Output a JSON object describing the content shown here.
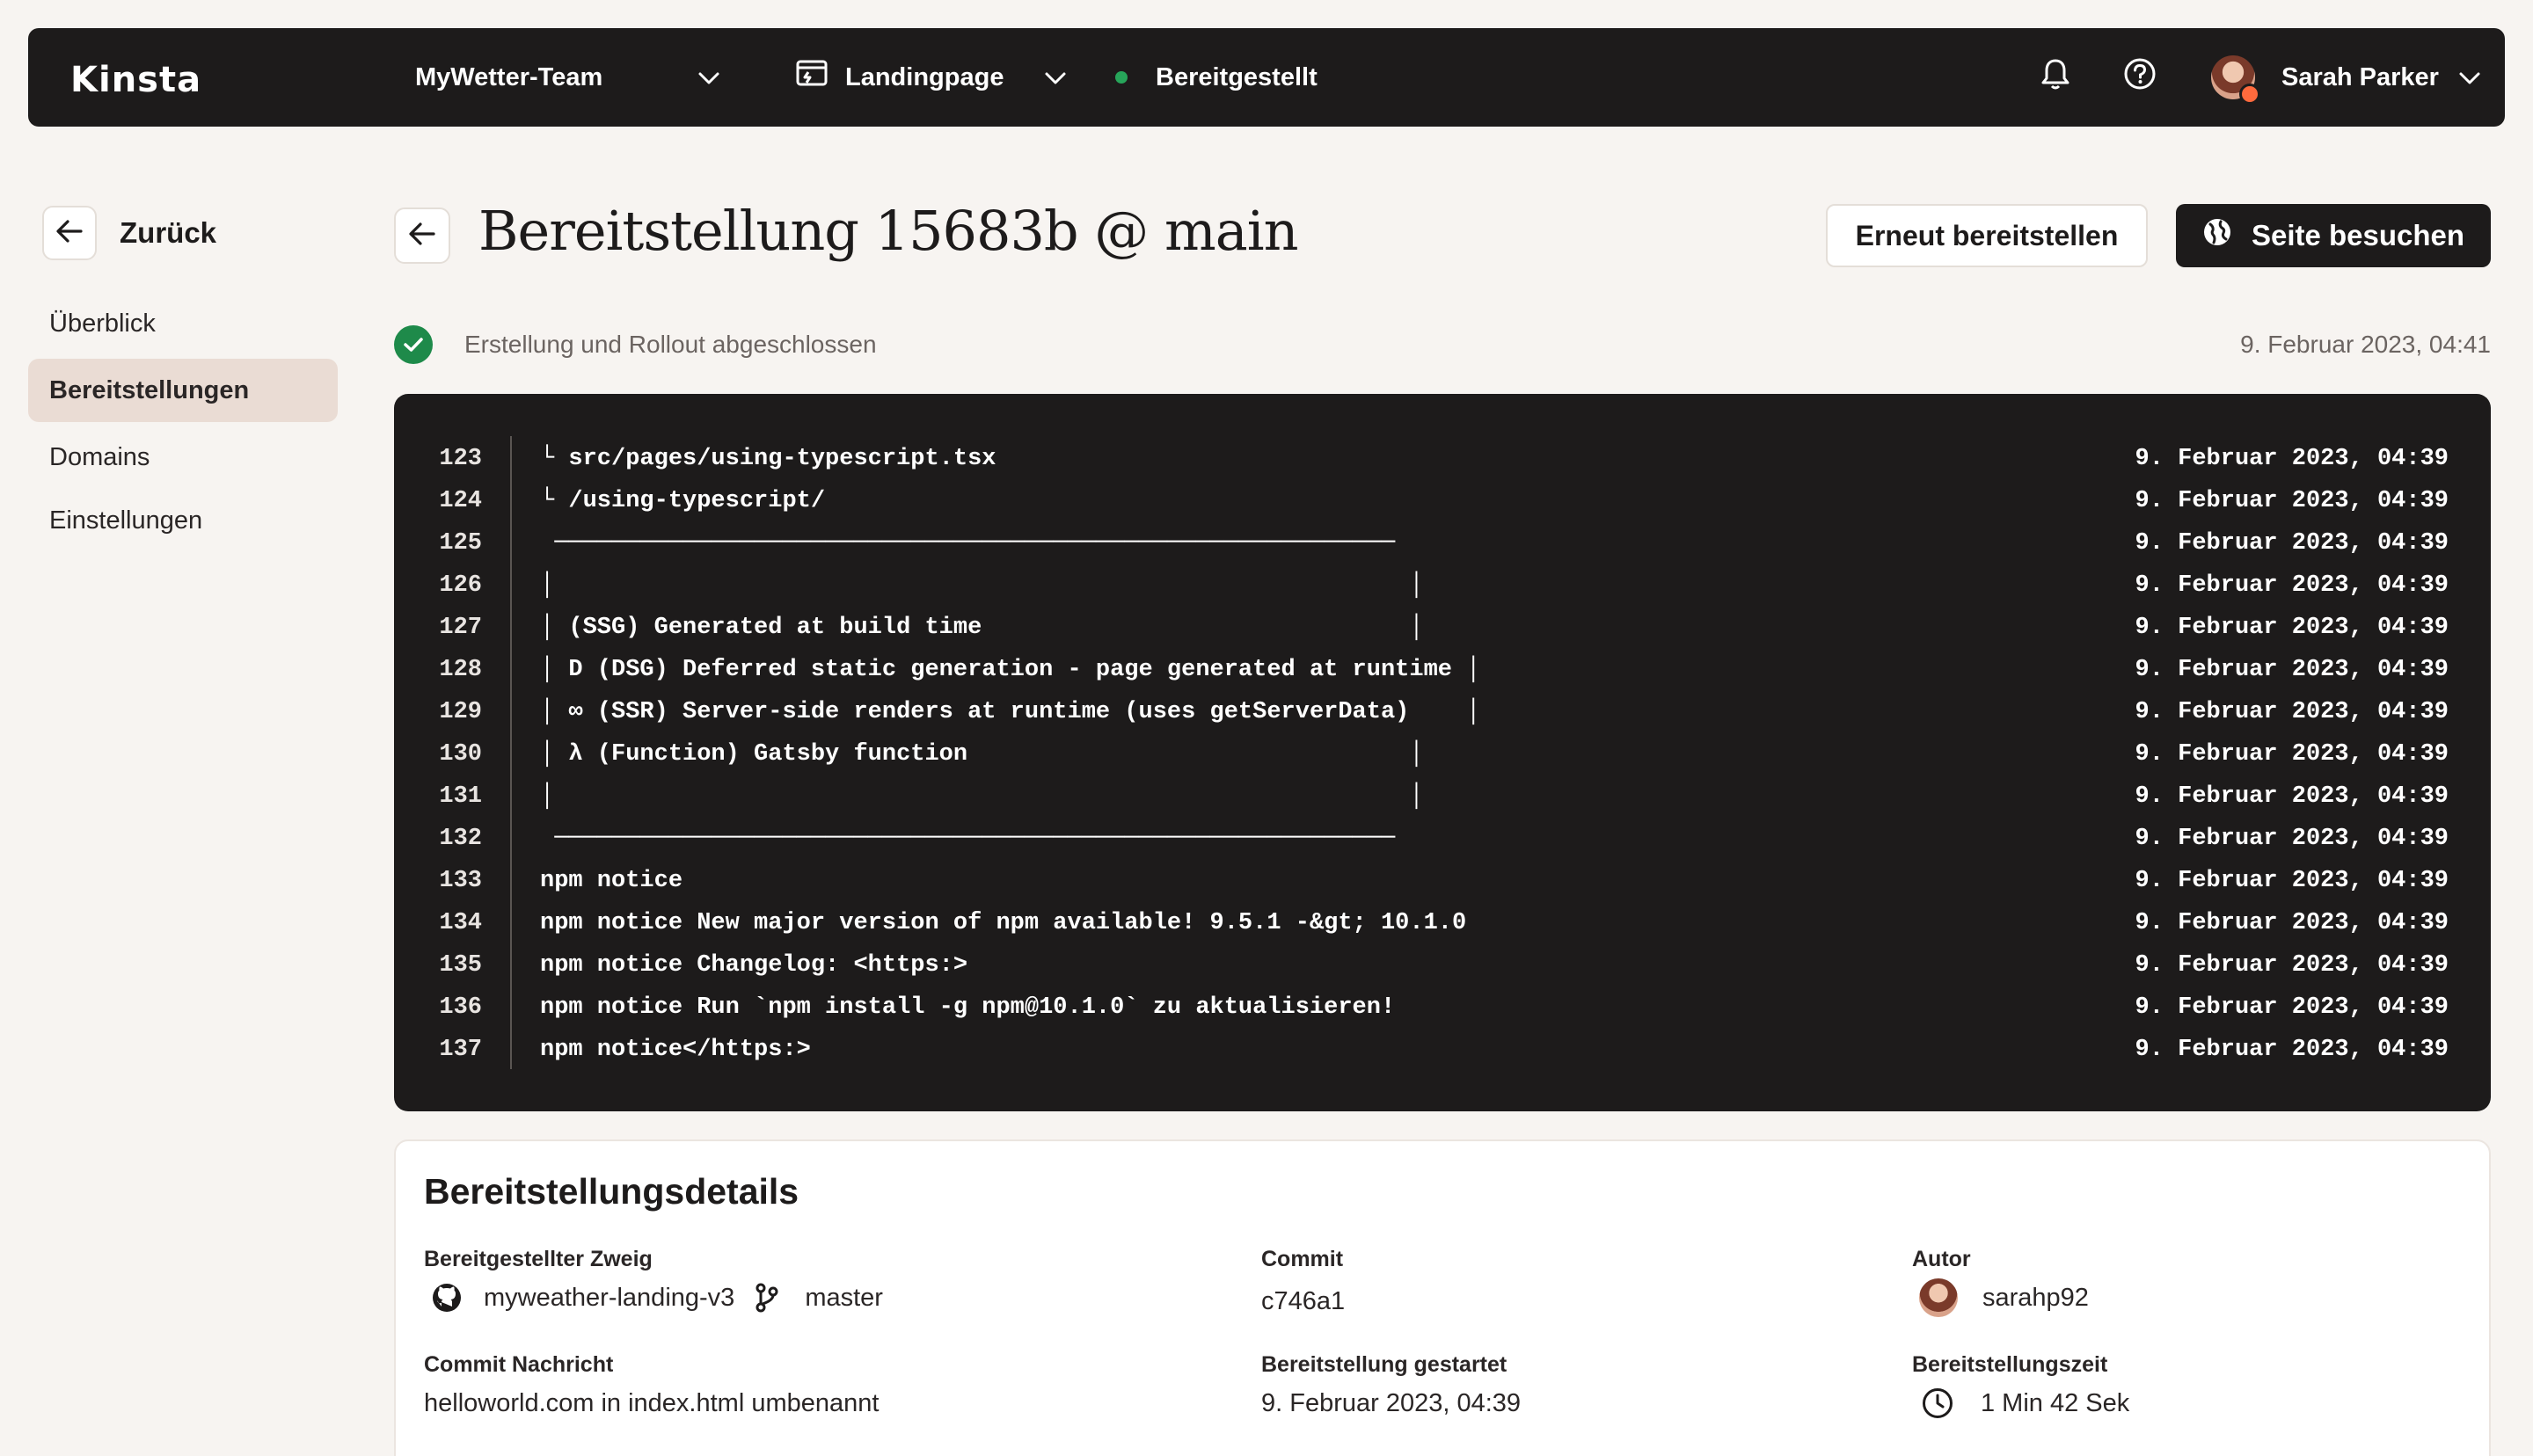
{
  "topbar": {
    "logo": "Kinsta",
    "team": "MyWetter-Team",
    "site": "Landingpage",
    "status": "Bereitgestellt",
    "user": "Sarah Parker"
  },
  "sidebar": {
    "back_label": "Zurück",
    "items": [
      {
        "label": "Überblick"
      },
      {
        "label": "Bereitstellungen"
      },
      {
        "label": "Domains"
      },
      {
        "label": "Einstellungen"
      }
    ]
  },
  "header": {
    "title": "Bereitstellung 15683b @ main",
    "redeploy_label": "Erneut bereitstellen",
    "visit_label": "Seite besuchen"
  },
  "status": {
    "text": "Erstellung und Rollout abgeschlossen",
    "date": "9. Februar 2023, 04:41"
  },
  "log": [
    {
      "n": "123",
      "t": "└ src/pages/using-typescript.tsx",
      "d": "9. Februar 2023, 04:39"
    },
    {
      "n": "124",
      "t": "└ /using-typescript/",
      "d": "9. Februar 2023, 04:39"
    },
    {
      "n": "125",
      "t": " ───────────────────────────────────────────────────────────",
      "d": "9. Februar 2023, 04:39"
    },
    {
      "n": "126",
      "t": "│                                                            │",
      "d": "9. Februar 2023, 04:39"
    },
    {
      "n": "127",
      "t": "│ (SSG) Generated at build time                              │",
      "d": "9. Februar 2023, 04:39"
    },
    {
      "n": "128",
      "t": "│ D (DSG) Deferred static generation - page generated at runtime │",
      "d": "9. Februar 2023, 04:39"
    },
    {
      "n": "129",
      "t": "│ ∞ (SSR) Server-side renders at runtime (uses getServerData)    │",
      "d": "9. Februar 2023, 04:39"
    },
    {
      "n": "130",
      "t": "│ λ (Function) Gatsby function                               │",
      "d": "9. Februar 2023, 04:39"
    },
    {
      "n": "131",
      "t": "│                                                            │",
      "d": "9. Februar 2023, 04:39"
    },
    {
      "n": "132",
      "t": " ───────────────────────────────────────────────────────────",
      "d": "9. Februar 2023, 04:39"
    },
    {
      "n": "133",
      "t": "npm notice",
      "d": "9. Februar 2023, 04:39"
    },
    {
      "n": "134",
      "t": "npm notice New major version of npm available! 9.5.1 -&gt; 10.1.0",
      "d": "9. Februar 2023, 04:39"
    },
    {
      "n": "135",
      "t": "npm notice Changelog: <https:>",
      "d": "9. Februar 2023, 04:39"
    },
    {
      "n": "136",
      "t": "npm notice Run `npm install -g npm@10.1.0` zu aktualisieren!",
      "d": "9. Februar 2023, 04:39"
    },
    {
      "n": "137",
      "t": "npm notice</https:>",
      "d": "9. Februar 2023, 04:39"
    }
  ],
  "details": {
    "title": "Bereitstellungsdetails",
    "branch_label": "Bereitgestellter Zweig",
    "repo": "myweather-landing-v3",
    "branch": "master",
    "commit_label": "Commit",
    "commit": "c746a1",
    "author_label": "Autor",
    "author": "sarahp92",
    "message_label": "Commit Nachricht",
    "message": "helloworld.com in index.html umbenannt",
    "started_label": "Bereitstellung gestartet",
    "started": "9. Februar 2023, 04:39",
    "duration_label": "Bereitstellungszeit",
    "duration": "1 Min 42 Sek"
  }
}
